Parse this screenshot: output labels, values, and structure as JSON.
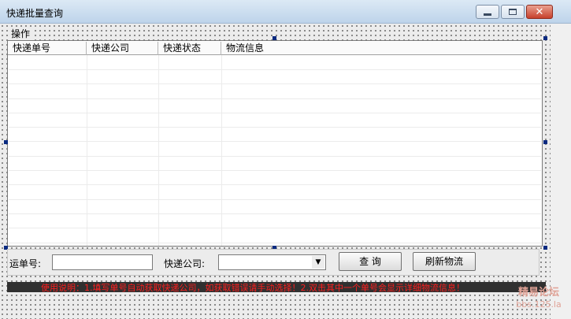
{
  "window": {
    "title": "快递批量查询",
    "min_label": "minimize",
    "max_label": "maximize",
    "close_label": "close"
  },
  "menu": {
    "items": [
      "操作"
    ]
  },
  "grid": {
    "columns": [
      "快递单号",
      "快递公司",
      "快递状态",
      "物流信息"
    ]
  },
  "form": {
    "tracking_label": "运单号:",
    "tracking_value": "",
    "company_label": "快递公司:",
    "company_value": "",
    "query_button": "查  询",
    "refresh_button": "刷新物流"
  },
  "status": {
    "text": "使用说明：1.填写单号自动获取快递公司，如获取错误请手动选择！2.双击其中一个单号会显示详细物流信息！"
  },
  "watermark": {
    "line1": "精易论坛",
    "line2": "bbs.125.la"
  },
  "icons": {
    "minimize": "minimize-icon",
    "maximize": "maximize-icon",
    "close": "close-icon",
    "dropdown": "chevron-down-icon"
  }
}
